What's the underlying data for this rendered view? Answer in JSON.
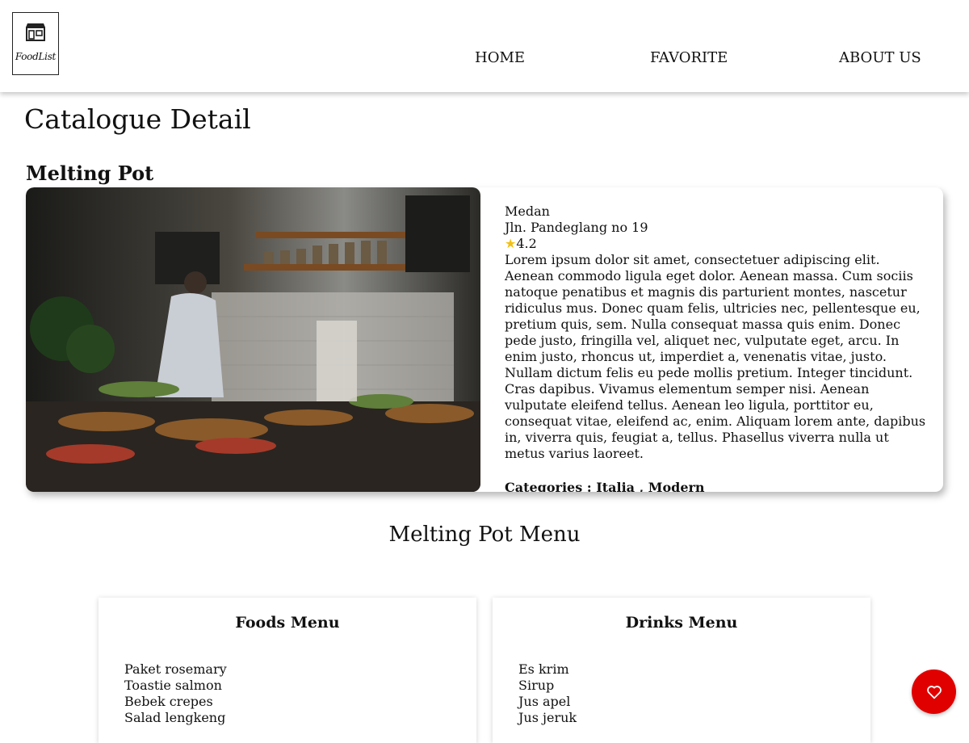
{
  "header": {
    "logo_text": "FoodList",
    "nav": [
      {
        "label": "HOME"
      },
      {
        "label": "FAVORITE"
      },
      {
        "label": "ABOUT US"
      }
    ]
  },
  "page_title": "Catalogue Detail",
  "restaurant": {
    "name": "Melting Pot",
    "city": "Medan",
    "address": "Jln. Pandeglang no 19",
    "rating_icon": "star-icon",
    "rating": "4.2",
    "description": "Lorem ipsum dolor sit amet, consectetuer adipiscing elit. Aenean commodo ligula eget dolor. Aenean massa. Cum sociis natoque penatibus et magnis dis parturient montes, nascetur ridiculus mus. Donec quam felis, ultricies nec, pellentesque eu, pretium quis, sem. Nulla consequat massa quis enim. Donec pede justo, fringilla vel, aliquet nec, vulputate eget, arcu. In enim justo, rhoncus ut, imperdiet a, venenatis vitae, justo. Nullam dictum felis eu pede mollis pretium. Integer tincidunt. Cras dapibus. Vivamus elementum semper nisi. Aenean vulputate eleifend tellus. Aenean leo ligula, porttitor eu, consequat vitae, eleifend ac, enim. Aliquam lorem ante, dapibus in, viverra quis, feugiat a, tellus. Phasellus viverra nulla ut metus varius laoreet.",
    "categories": "Categories : Italia , Modern"
  },
  "menu": {
    "title": "Melting Pot Menu",
    "foods": {
      "title": "Foods Menu",
      "items": [
        "Paket rosemary",
        "Toastie salmon",
        "Bebek crepes",
        "Salad lengkeng"
      ]
    },
    "drinks": {
      "title": "Drinks Menu",
      "items": [
        "Es krim",
        "Sirup",
        "Jus apel",
        "Jus jeruk"
      ]
    }
  },
  "favorite_button": {
    "icon": "heart-icon",
    "color": "#e00000"
  }
}
